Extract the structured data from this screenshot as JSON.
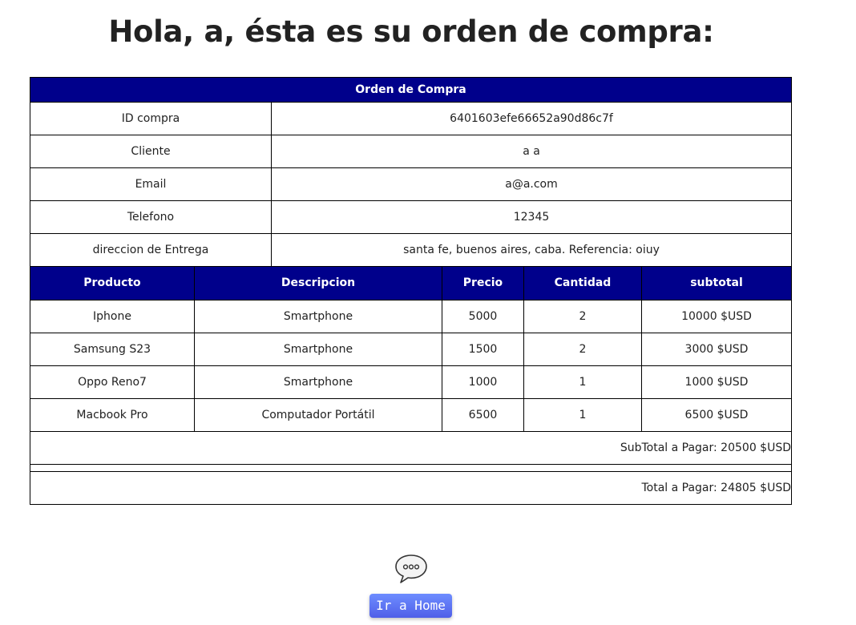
{
  "heading": "Hola, a, ésta es su orden de compra:",
  "order": {
    "title": "Orden de Compra",
    "info": [
      {
        "label": "ID compra",
        "value": "6401603efe66652a90d86c7f"
      },
      {
        "label": "Cliente",
        "value": "a a"
      },
      {
        "label": "Email",
        "value": "a@a.com"
      },
      {
        "label": "Telefono",
        "value": "12345"
      },
      {
        "label": "direccion de Entrega",
        "value": "santa fe, buenos aires, caba. Referencia: oiuy"
      }
    ],
    "columns": [
      "Producto",
      "Descripcion",
      "Precio",
      "Cantidad",
      "subtotal"
    ],
    "items": [
      [
        "Iphone",
        "Smartphone",
        "5000",
        "2",
        "10000 $USD"
      ],
      [
        "Samsung S23",
        "Smartphone",
        "1500",
        "2",
        "3000 $USD"
      ],
      [
        "Oppo Reno7",
        "Smartphone",
        "1000",
        "1",
        "1000 $USD"
      ],
      [
        "Macbook Pro",
        "Computador Portátil",
        "6500",
        "1",
        "6500 $USD"
      ]
    ],
    "subtotal_text": "SubTotal a Pagar: 20500 $USD",
    "total_text": "Total a Pagar: 24805 $USD"
  },
  "chat_icon": "speech-bubble-icon",
  "home_button": "Ir a Home",
  "colors": {
    "header_bg": "#00008b",
    "header_text": "#ffffff",
    "button_start": "#6e8dff",
    "button_end": "#4f5fe8"
  }
}
